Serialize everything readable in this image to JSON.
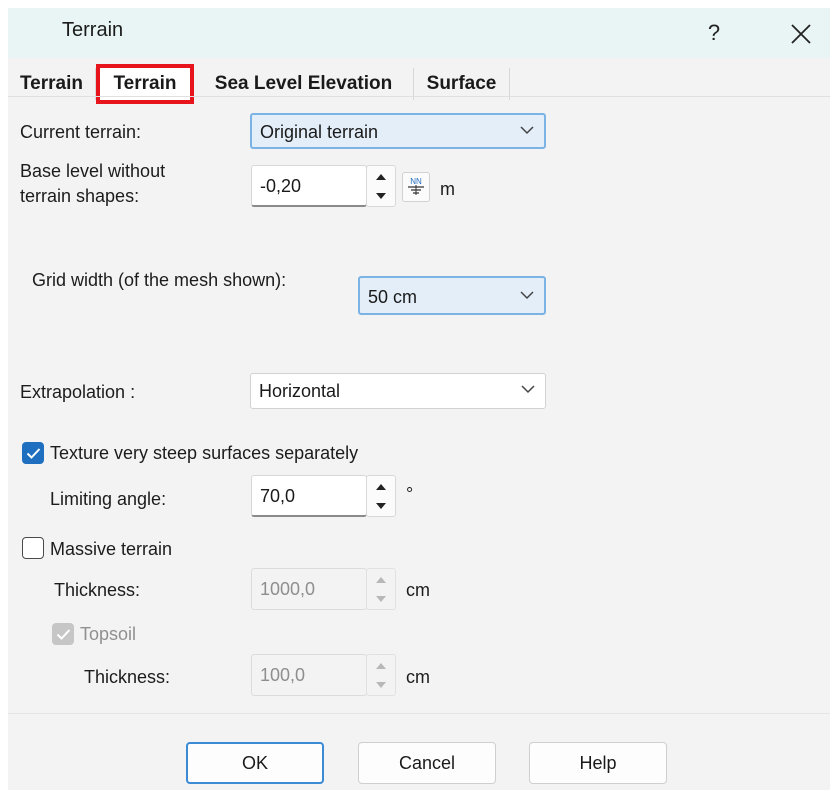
{
  "window": {
    "title": "Terrain",
    "help_glyph": "?"
  },
  "tabs": [
    {
      "label": "Terrain"
    },
    {
      "label": "Terrain",
      "active": true,
      "highlight_color": "#e8141c"
    },
    {
      "label": "Sea Level Elevation"
    },
    {
      "label": "Surface"
    }
  ],
  "form": {
    "current_terrain": {
      "label": "Current terrain:",
      "value": "Original terrain"
    },
    "base_level": {
      "label_line1": "Base level without",
      "label_line2": "terrain shapes:",
      "value": "-0,20",
      "unit": "m",
      "nn_icon": "NN"
    },
    "grid_width": {
      "label": "Grid width (of the mesh shown):",
      "value": "50 cm"
    },
    "extrapolation": {
      "label": "Extrapolation :",
      "value": "Horizontal"
    },
    "texture_steep": {
      "label": "Texture very steep surfaces separately",
      "checked": true
    },
    "limiting_angle": {
      "label": "Limiting angle:",
      "value": "70,0",
      "unit": "°"
    },
    "massive_terrain": {
      "label": "Massive terrain",
      "checked": false
    },
    "massive_thickness": {
      "label": "Thickness:",
      "value": "1000,0",
      "unit": "cm"
    },
    "topsoil": {
      "label": "Topsoil",
      "checked": true,
      "enabled": false
    },
    "topsoil_thickness": {
      "label": "Thickness:",
      "value": "100,0",
      "unit": "cm"
    }
  },
  "buttons": {
    "ok": "OK",
    "cancel": "Cancel",
    "help": "Help"
  },
  "colors": {
    "accent": "#1e6fc0",
    "focus_border": "#7ab3e4",
    "title_bg": "#e8f5f4"
  }
}
